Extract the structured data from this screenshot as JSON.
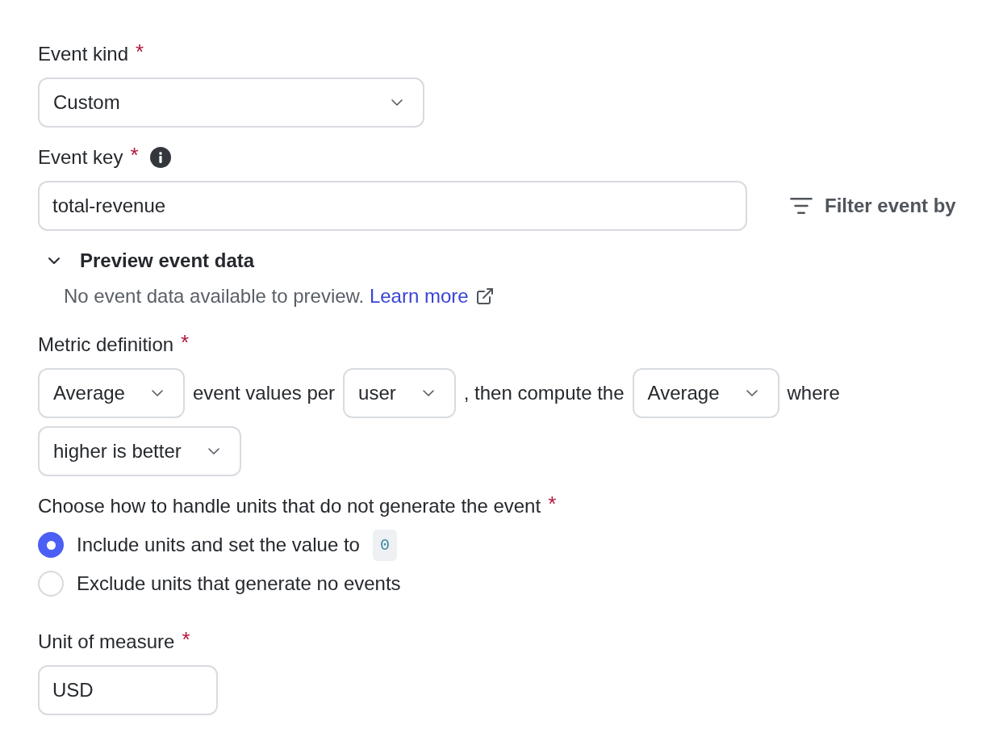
{
  "event_kind": {
    "label": "Event kind",
    "required_mark": "*",
    "value": "Custom"
  },
  "event_key": {
    "label": "Event key",
    "required_mark": "*",
    "value": "total-revenue",
    "filter_button": "Filter event by"
  },
  "preview": {
    "title": "Preview event data",
    "expanded": true,
    "message": "No event data available to preview.",
    "link": "Learn more"
  },
  "metric_definition": {
    "label": "Metric definition",
    "required_mark": "*",
    "parts": [
      {
        "kind": "select",
        "value": "Average"
      },
      {
        "kind": "text",
        "text": "event values per"
      },
      {
        "kind": "select",
        "value": "user"
      },
      {
        "kind": "text",
        "text": ", then compute the"
      },
      {
        "kind": "select",
        "value": "Average"
      },
      {
        "kind": "text",
        "text": "where"
      },
      {
        "kind": "select",
        "value": "higher is better"
      }
    ]
  },
  "missing_events": {
    "label": "Choose how to handle units that do not generate the event",
    "required_mark": "*",
    "options": [
      {
        "label": "Include units and set the value to",
        "code": "0",
        "selected": true
      },
      {
        "label": "Exclude units that generate no events",
        "selected": false
      }
    ]
  },
  "unit_of_measure": {
    "label": "Unit of measure",
    "required_mark": "*",
    "value": "USD"
  }
}
